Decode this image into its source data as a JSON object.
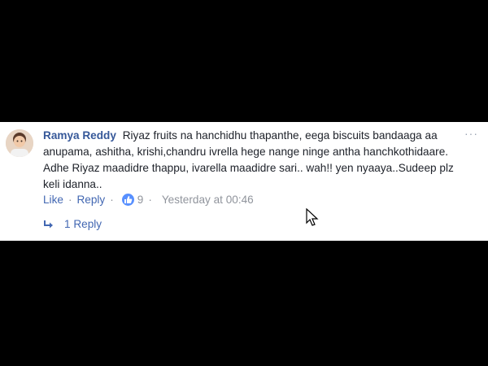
{
  "comment": {
    "author": "Ramya Reddy",
    "text": "Riyaz fruits na hanchidhu thapanthe, eega biscuits bandaaga aa anupama, ashitha, krishi,chandru ivrella hege nange ninge antha hanchkothidaare. Adhe Riyaz maadidre thappu, ivarella maadidre sari.. wah!! yen nyaaya..Sudeep plz keli idanna..",
    "more_icon": "···"
  },
  "actions": {
    "like_label": "Like",
    "reply_label": "Reply",
    "separator": "·",
    "reaction_count": "9",
    "timestamp": "Yesterday at 00:46"
  },
  "replies": {
    "label": "1 Reply"
  },
  "colors": {
    "author": "#365899",
    "link": "#4267b2",
    "meta": "#90949c",
    "like_badge": "#5890ff"
  },
  "icons": [
    "avatar",
    "more-options-icon",
    "like-reaction-icon",
    "reply-arrow-icon",
    "mouse-cursor-icon"
  ]
}
